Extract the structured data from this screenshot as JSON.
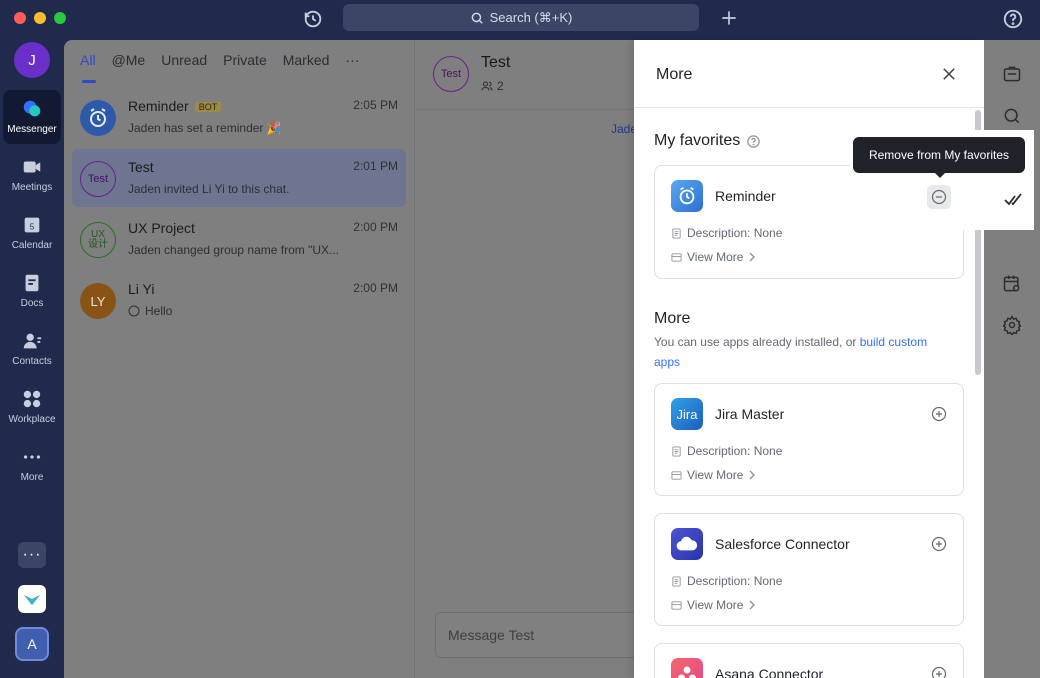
{
  "titlebar": {
    "search_label": "Search (⌘+K)"
  },
  "rail": {
    "avatar_letter": "J",
    "items": [
      {
        "label": "Messenger",
        "icon": "messenger-icon"
      },
      {
        "label": "Meetings",
        "icon": "video-icon"
      },
      {
        "label": "Calendar",
        "icon": "calendar-icon",
        "badge": "5"
      },
      {
        "label": "Docs",
        "icon": "docs-icon"
      },
      {
        "label": "Contacts",
        "icon": "contacts-icon"
      },
      {
        "label": "Workplace",
        "icon": "workplace-icon"
      },
      {
        "label": "More",
        "icon": "more-dots-icon"
      }
    ],
    "bottom_app_letter": "A"
  },
  "chatlist": {
    "tabs": [
      "All",
      "@Me",
      "Unread",
      "Private",
      "Marked",
      "···"
    ],
    "chats": [
      {
        "name": "Reminder",
        "badge": "BOT",
        "time": "2:05 PM",
        "preview": "Jaden has set a reminder 🎉",
        "avatar": "alarm-clock-icon"
      },
      {
        "name": "Test",
        "time": "2:01 PM",
        "preview": "Jaden invited Li Yi to this chat.",
        "avatar_text": "Test"
      },
      {
        "name": "UX Project",
        "time": "2:00 PM",
        "preview": "Jaden changed group name from \"UX...",
        "avatar_text": "UX\n设计"
      },
      {
        "name": "Li Yi",
        "time": "2:00 PM",
        "preview": "Hello",
        "avatar_text": "LY"
      }
    ]
  },
  "chatmain": {
    "avatar_text": "Test",
    "title": "Test",
    "member_count": "2",
    "link_text": "Jade",
    "input_placeholder": "Message Test"
  },
  "more_panel": {
    "title": "More",
    "favorites_title": "My favorites",
    "favorites": [
      {
        "name": "Reminder",
        "description": "Description: None",
        "view_more": "View More"
      }
    ],
    "more_title": "More",
    "more_sub_prefix": "You can use apps already installed, or ",
    "more_sub_link": "build custom apps",
    "apps": [
      {
        "name": "Jira Master",
        "icon_text": "Jira",
        "description": "Description: None",
        "view_more": "View More"
      },
      {
        "name": "Salesforce Connector",
        "description": "Description: None",
        "view_more": "View More"
      },
      {
        "name": "Asana Connector"
      }
    ]
  },
  "tooltip": {
    "text": "Remove from My favorites"
  }
}
